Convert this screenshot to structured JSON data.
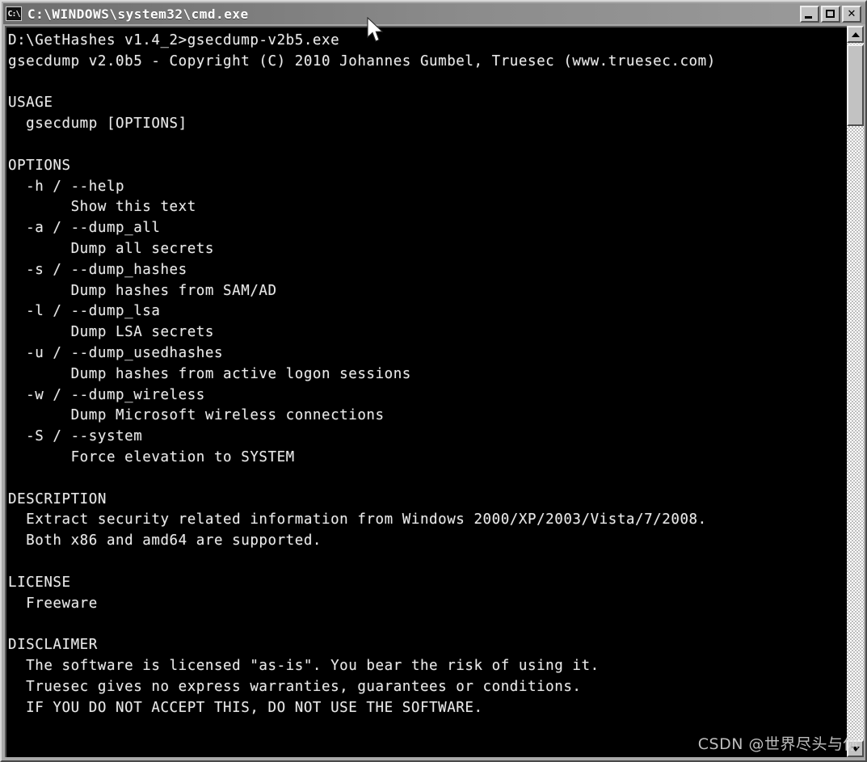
{
  "window": {
    "title": "C:\\WINDOWS\\system32\\cmd.exe",
    "icon_label": "C:\\",
    "buttons": {
      "minimize": "Minimize",
      "maximize": "Maximize",
      "close": "✕"
    }
  },
  "scrollbar": {
    "up_arrow": "scroll-up",
    "down_arrow": "scroll-down",
    "thumb": "scroll-thumb"
  },
  "console": {
    "lines": [
      "D:\\GetHashes v1.4_2>gsecdump-v2b5.exe",
      "gsecdump v2.0b5 - Copyright (C) 2010 Johannes Gumbel, Truesec (www.truesec.com)",
      "",
      "USAGE",
      "  gsecdump [OPTIONS]",
      "",
      "OPTIONS",
      "  -h / --help",
      "       Show this text",
      "  -a / --dump_all",
      "       Dump all secrets",
      "  -s / --dump_hashes",
      "       Dump hashes from SAM/AD",
      "  -l / --dump_lsa",
      "       Dump LSA secrets",
      "  -u / --dump_usedhashes",
      "       Dump hashes from active logon sessions",
      "  -w / --dump_wireless",
      "       Dump Microsoft wireless connections",
      "  -S / --system",
      "       Force elevation to SYSTEM",
      "",
      "DESCRIPTION",
      "  Extract security related information from Windows 2000/XP/2003/Vista/7/2008.",
      "  Both x86 and amd64 are supported.",
      "",
      "LICENSE",
      "  Freeware",
      "",
      "DISCLAIMER",
      "  The software is licensed \"as-is\". You bear the risk of using it.",
      "  Truesec gives no express warranties, guarantees or conditions.",
      "  IF YOU DO NOT ACCEPT THIS, DO NOT USE THE SOFTWARE."
    ],
    "prompt_path": "D:\\GetHashes v1.4_2",
    "command": "gsecdump-v2b5.exe",
    "program": "gsecdump",
    "version": "v2.0b5",
    "copyright": "Copyright (C) 2010 Johannes Gumbel, Truesec (www.truesec.com)",
    "sections": {
      "usage": "USAGE",
      "options": "OPTIONS",
      "description": "DESCRIPTION",
      "license": "LICENSE",
      "disclaimer": "DISCLAIMER"
    },
    "options": [
      {
        "flags": "-h / --help",
        "description": "Show this text"
      },
      {
        "flags": "-a / --dump_all",
        "description": "Dump all secrets"
      },
      {
        "flags": "-s / --dump_hashes",
        "description": "Dump hashes from SAM/AD"
      },
      {
        "flags": "-l / --dump_lsa",
        "description": "Dump LSA secrets"
      },
      {
        "flags": "-u / --dump_usedhashes",
        "description": "Dump hashes from active logon sessions"
      },
      {
        "flags": "-w / --dump_wireless",
        "description": "Dump Microsoft wireless connections"
      },
      {
        "flags": "-S / --system",
        "description": "Force elevation to SYSTEM"
      }
    ],
    "license_value": "Freeware"
  },
  "watermark": {
    "text": "CSDN @世界尽头与你"
  },
  "colors": {
    "console_bg": "#000000",
    "console_fg": "#e9e9e9",
    "window_chrome": "#a9a9a9",
    "titlebar": "#8c8c8c"
  }
}
